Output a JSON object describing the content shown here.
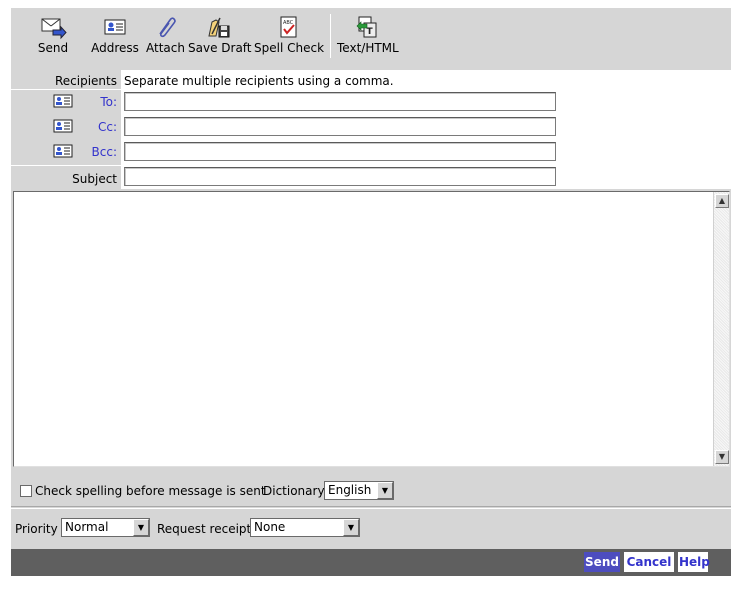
{
  "toolbar": {
    "send": {
      "label": "Send",
      "icon": "send-icon"
    },
    "address": {
      "label": "Address",
      "icon": "address-book-icon"
    },
    "attach": {
      "label": "Attach",
      "icon": "paperclip-icon"
    },
    "save_draft": {
      "label": "Save Draft",
      "icon": "save-draft-icon"
    },
    "spell_check": {
      "label": "Spell Check",
      "icon": "spell-check-icon"
    },
    "text_html": {
      "label": "Text/HTML",
      "icon": "text-html-icon"
    }
  },
  "header": {
    "recipients_label": "Recipients",
    "recipients_hint": "Separate multiple recipients using a comma.",
    "to_label": "To:",
    "cc_label": "Cc:",
    "bcc_label": "Bcc:",
    "subject_label": "Subject",
    "to_value": "",
    "cc_value": "",
    "bcc_value": "",
    "subject_value": ""
  },
  "body": {
    "value": ""
  },
  "options": {
    "check_spelling_label": "Check spelling before message is sent",
    "check_spelling_checked": false,
    "dictionary_label": "Dictionary",
    "dictionary_value": "English",
    "priority_label": "Priority",
    "priority_value": "Normal",
    "receipt_label": "Request receipt",
    "receipt_value": "None"
  },
  "footer": {
    "send_label": "Send",
    "cancel_label": "Cancel",
    "help_label": "Help"
  },
  "colors": {
    "panel": "#d6d6d6",
    "link_blue": "#3333cc",
    "send_button": "#4d4dbf",
    "footer_bar": "#5f5f5f"
  }
}
